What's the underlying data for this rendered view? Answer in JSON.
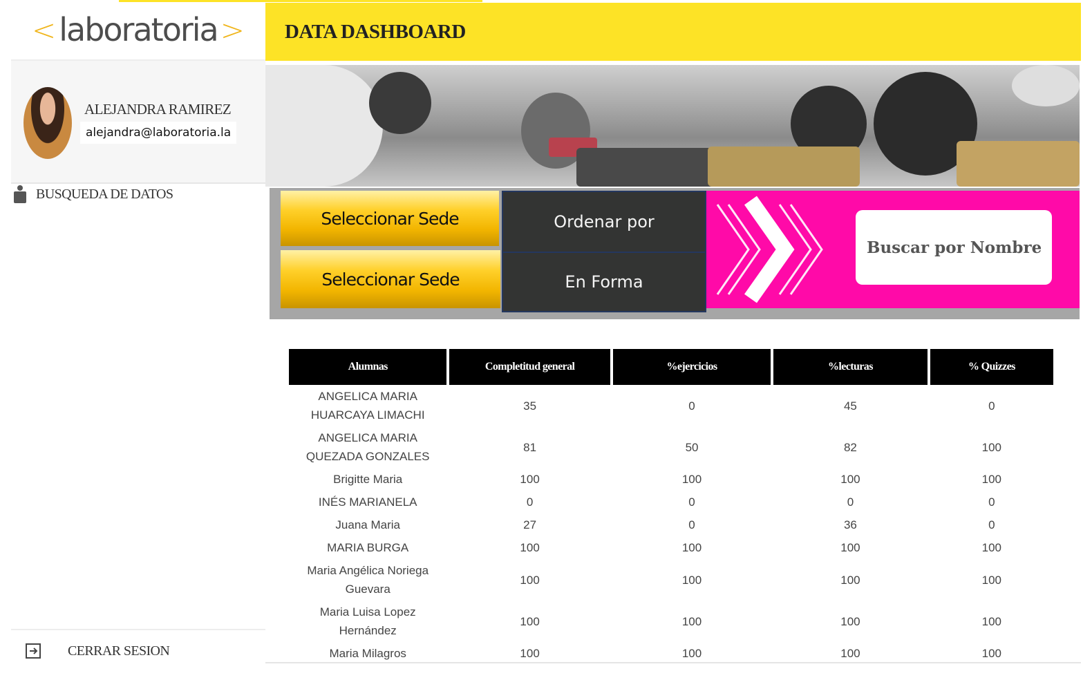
{
  "logo": {
    "left_bracket": "<",
    "word": "laboratoria",
    "right_bracket": ">"
  },
  "header": {
    "title": "DATA DASHBOARD"
  },
  "user": {
    "name": "ALEJANDRA RAMIREZ",
    "email": "alejandra@laboratoria.la"
  },
  "sidebar": {
    "nav_label": "BUSQUEDA DE DATOS",
    "logout_label": "CERRAR SESION"
  },
  "controls": {
    "sede_1": "Seleccionar Sede",
    "sede_2": "Seleccionar Sede",
    "order_label": "Ordenar por",
    "order_value": "En Forma",
    "search_placeholder": "Buscar por Nombre...."
  },
  "colors": {
    "accent_yellow": "#fde326",
    "pink": "#ff0aa8",
    "dark": "#333433"
  },
  "table": {
    "headers": [
      "Alumnas",
      "Completitud general",
      "%ejercicios",
      "%lecturas",
      "% Quizzes"
    ],
    "rows": [
      [
        "ANGELICA MARIA HUARCAYA LIMACHI",
        "35",
        "0",
        "45",
        "0"
      ],
      [
        "ANGELICA MARIA QUEZADA GONZALES",
        "81",
        "50",
        "82",
        "100"
      ],
      [
        "Brigitte Maria",
        "100",
        "100",
        "100",
        "100"
      ],
      [
        "INÉS MARIANELA",
        "0",
        "0",
        "0",
        "0"
      ],
      [
        "Juana Maria",
        "27",
        "0",
        "36",
        "0"
      ],
      [
        "MARIA BURGA",
        "100",
        "100",
        "100",
        "100"
      ],
      [
        "Maria Angélica Noriega Guevara",
        "100",
        "100",
        "100",
        "100"
      ],
      [
        "Maria Luisa Lopez Hernández",
        "100",
        "100",
        "100",
        "100"
      ],
      [
        "Maria Milagros",
        "100",
        "100",
        "100",
        "100"
      ]
    ]
  }
}
